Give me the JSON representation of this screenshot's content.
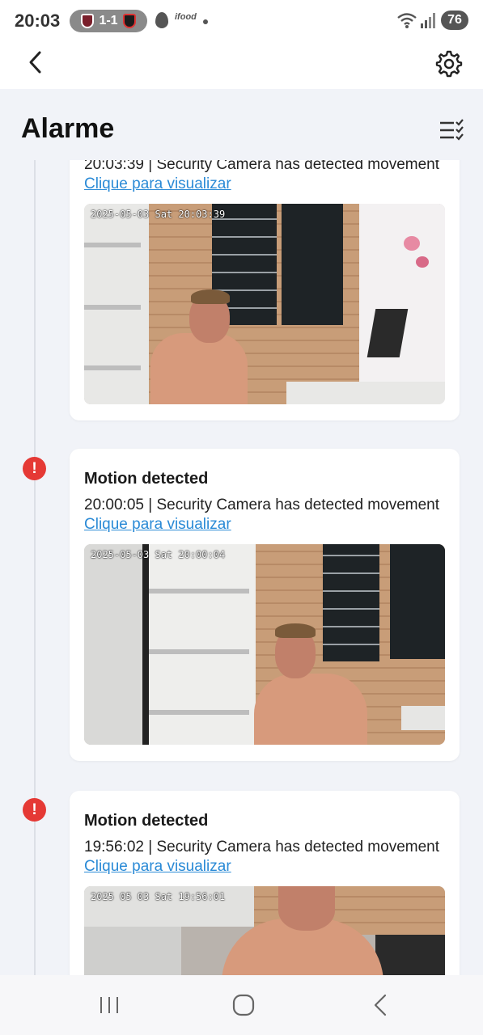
{
  "status_bar": {
    "time": "20:03",
    "score": "1-1",
    "ifood": "ifood",
    "battery": "76"
  },
  "header": {
    "title": "Alarme",
    "icons": {
      "back": "chevron-left-icon",
      "settings": "gear-icon",
      "filter": "checklist-filter-icon"
    }
  },
  "events": [
    {
      "desc_prefix": "20:03:39 | Security Camera has detected movement ",
      "link": "Clique para visualizar",
      "timestamp": "2025-05-03 Sat 20:03:39"
    },
    {
      "title": "Motion detected",
      "desc_prefix": "20:00:05 | Security Camera has detected movement ",
      "link": "Clique para visualizar",
      "timestamp": "2025-05-03 Sat 20:00:04"
    },
    {
      "title": "Motion detected",
      "desc_prefix": "19:56:02 | Security Camera has detected movement ",
      "link": "Clique para visualizar",
      "timestamp": "2025 05 03 Sat 19:56:01"
    }
  ],
  "alert_icon": "!",
  "nav_bar": {
    "icons": [
      "recent-apps-icon",
      "home-icon",
      "back-icon"
    ]
  }
}
